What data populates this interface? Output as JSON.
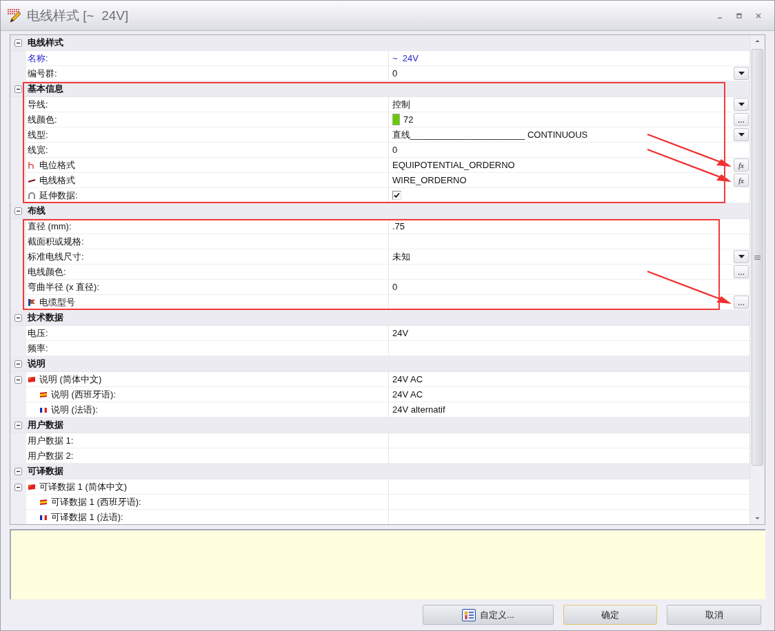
{
  "window": {
    "title": "电线样式 [~  24V]"
  },
  "sections": [
    {
      "title": "电线样式",
      "expanded": true,
      "kind": "plain",
      "rows": [
        {
          "label": "名称:",
          "kind": "text",
          "value": "~  24V",
          "emphasized": true,
          "arrow": false
        },
        {
          "label": "编号群:",
          "kind": "text",
          "value": "0",
          "emphasized": false,
          "arrow": false,
          "button": {
            "kind": "dropdown"
          }
        }
      ]
    },
    {
      "title": "基本信息",
      "expanded": true,
      "kind": "outlined_with_header",
      "rows": [
        {
          "label": "导线:",
          "kind": "text",
          "value": "控制",
          "emphasized": false,
          "arrow": false,
          "button": {
            "kind": "dropdown"
          }
        },
        {
          "label": "线颜色:",
          "kind": "color",
          "color": "#66cc00",
          "value": "72",
          "emphasized": false,
          "arrow": false,
          "button": {
            "kind": "browse",
            "label": "..."
          }
        },
        {
          "label": "线型:",
          "kind": "text",
          "value": "直线_______________________ CONTINUOUS",
          "emphasized": false,
          "arrow": false,
          "button": {
            "kind": "dropdown"
          }
        },
        {
          "label": "线宽:",
          "kind": "text",
          "value": "0",
          "emphasized": false,
          "arrow": false
        },
        {
          "label": "电位格式",
          "kind": "potential",
          "value": "EQUIPOTENTIAL_ORDERNO",
          "emphasized": false,
          "arrow": true,
          "button": {
            "kind": "formula",
            "label": "fx"
          }
        },
        {
          "label": "电线格式",
          "kind": "wire",
          "value": "WIRE_ORDERNO",
          "emphasized": false,
          "arrow": true,
          "button": {
            "kind": "formula",
            "label": "fx"
          }
        },
        {
          "label": "延伸数据:",
          "kind": "checkbox",
          "checked": true,
          "emphasized": false,
          "arrow": false
        }
      ]
    },
    {
      "title": "布线",
      "expanded": true,
      "kind": "outlined_rows",
      "rows": [
        {
          "label": "直径 (mm):",
          "kind": "text",
          "value": ".75",
          "emphasized": false,
          "arrow": false
        },
        {
          "label": "截面积或规格:",
          "kind": "text",
          "emphasized": false,
          "arrow": false
        },
        {
          "label": "标准电线尺寸:",
          "kind": "text",
          "value": "未知",
          "emphasized": false,
          "arrow": false,
          "button": {
            "kind": "dropdown"
          }
        },
        {
          "label": "电线颜色:",
          "kind": "text",
          "emphasized": false,
          "arrow": false,
          "button": {
            "kind": "browse",
            "label": "..."
          }
        },
        {
          "label": "弯曲半径 (x 直径):",
          "kind": "text",
          "value": "0",
          "emphasized": false,
          "arrow": false
        },
        {
          "label": "电缆型号",
          "kind": "cable",
          "emphasized": false,
          "arrow": true,
          "button": {
            "kind": "browse",
            "label": "..."
          }
        }
      ]
    },
    {
      "title": "技术数据",
      "expanded": true,
      "kind": "plain",
      "rows": [
        {
          "label": "电压:",
          "kind": "text",
          "value": "24V",
          "emphasized": false,
          "arrow": false
        },
        {
          "label": "频率:",
          "kind": "text",
          "emphasized": false,
          "arrow": false
        }
      ]
    },
    {
      "title": "说明",
      "expanded": true,
      "kind": "plain",
      "rows": [
        {
          "label": "说明 (简体中文)",
          "kind": "chinese",
          "value": "24V AC",
          "emphasized": false,
          "arrow": false,
          "expanded": true,
          "children": [
            {
              "label": "说明 (西班牙语):",
              "kind": "spanish",
              "value": "24V AC",
              "emphasized": false,
              "arrow": false
            },
            {
              "label": "说明 (法语):",
              "kind": "french",
              "value": "24V alternatif",
              "emphasized": false,
              "arrow": false
            }
          ]
        }
      ]
    },
    {
      "title": "用户数据",
      "expanded": true,
      "kind": "plain",
      "rows": [
        {
          "label": "用户数据 1:",
          "kind": "text",
          "emphasized": false,
          "arrow": false
        },
        {
          "label": "用户数据 2:",
          "kind": "text",
          "emphasized": false,
          "arrow": false
        }
      ]
    },
    {
      "title": "可译数据",
      "expanded": true,
      "kind": "plain",
      "rows": [
        {
          "label": "可译数据 1 (简体中文)",
          "kind": "chinese",
          "emphasized": false,
          "arrow": false,
          "expanded": true,
          "children": [
            {
              "label": "可译数据 1 (西班牙语):",
              "kind": "spanish",
              "emphasized": false,
              "arrow": false
            },
            {
              "label": "可译数据 1 (法语):",
              "kind": "french",
              "emphasized": false,
              "arrow": false
            }
          ]
        }
      ]
    }
  ],
  "buttons": [
    {
      "label": "自定义...",
      "kind": "icon_text",
      "default": false
    },
    {
      "label": "确定",
      "kind": "text",
      "default": true
    },
    {
      "label": "取消",
      "kind": "text",
      "default": false
    }
  ]
}
